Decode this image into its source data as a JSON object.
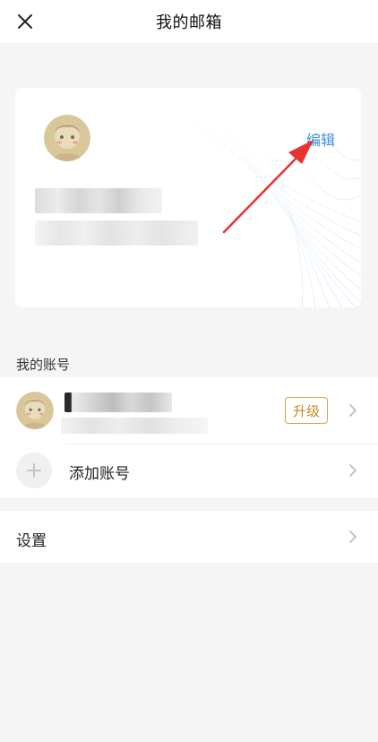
{
  "header": {
    "title": "我的邮箱",
    "close_icon": "close-icon"
  },
  "profile_card": {
    "edit_label": "编辑",
    "avatar_icon": "avatar-image",
    "name_blurred": true,
    "email_blurred": true
  },
  "accounts_section": {
    "label": "我的账号",
    "account": {
      "name_blurred": true,
      "email_blurred": true,
      "upgrade_label": "升级",
      "chevron_icon": "chevron-right-icon"
    },
    "add_account": {
      "label": "添加账号",
      "plus_icon": "plus-icon",
      "chevron_icon": "chevron-right-icon"
    }
  },
  "settings": {
    "label": "设置",
    "chevron_icon": "chevron-right-icon"
  },
  "colors": {
    "accent_blue": "#3c8ee6",
    "upgrade_gold": "#c48a25",
    "annotation_arrow": "#e8332e",
    "background": "#f5f5f5"
  }
}
